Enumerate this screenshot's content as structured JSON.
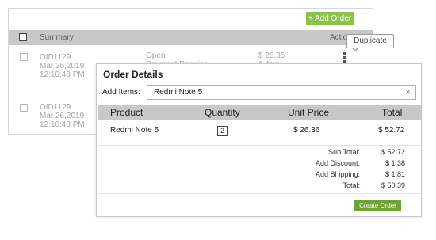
{
  "toolbar": {
    "add_order_label": "+ Add Order"
  },
  "list": {
    "header": {
      "summary_label": "Summary",
      "actions_label": "Actions"
    },
    "rows": [
      {
        "id": "OID1129",
        "date": "Mar 26,2019",
        "time": "12:10:48 PM",
        "status": "Open",
        "payment": "Payment Pending",
        "amount": "$ 26.35",
        "items": "1 item"
      },
      {
        "id": "OID1129",
        "date": "Mar 26,2019",
        "time": "12:10:48 PM"
      }
    ]
  },
  "tooltip": {
    "label": "Duplicate"
  },
  "modal": {
    "title": "Order Details",
    "add_items_label": "Add Items:",
    "add_items_value": "Redmi Note 5",
    "clear_icon": "×",
    "columns": {
      "product": "Product",
      "quantity": "Quantity",
      "unit_price": "Unit Price",
      "total": "Total"
    },
    "line_item": {
      "product": "Redmi Note 5",
      "quantity": "2",
      "unit_price": "$ 26.36",
      "total": "$ 52.72"
    },
    "summary": {
      "subtotal_label": "Sub Total:",
      "subtotal_value": "$ 52.72",
      "discount_label": "Add Discount:",
      "discount_value": "$ 1.38",
      "shipping_label": "Add Shipping:",
      "shipping_value": "$ 1.81",
      "total_label": "Total:",
      "total_value": "$ 50.39"
    },
    "create_label": "Create Order"
  },
  "colors": {
    "accent_green": "#8bc34a",
    "create_green": "#6fa332",
    "header_gray": "#c8c8c8"
  }
}
